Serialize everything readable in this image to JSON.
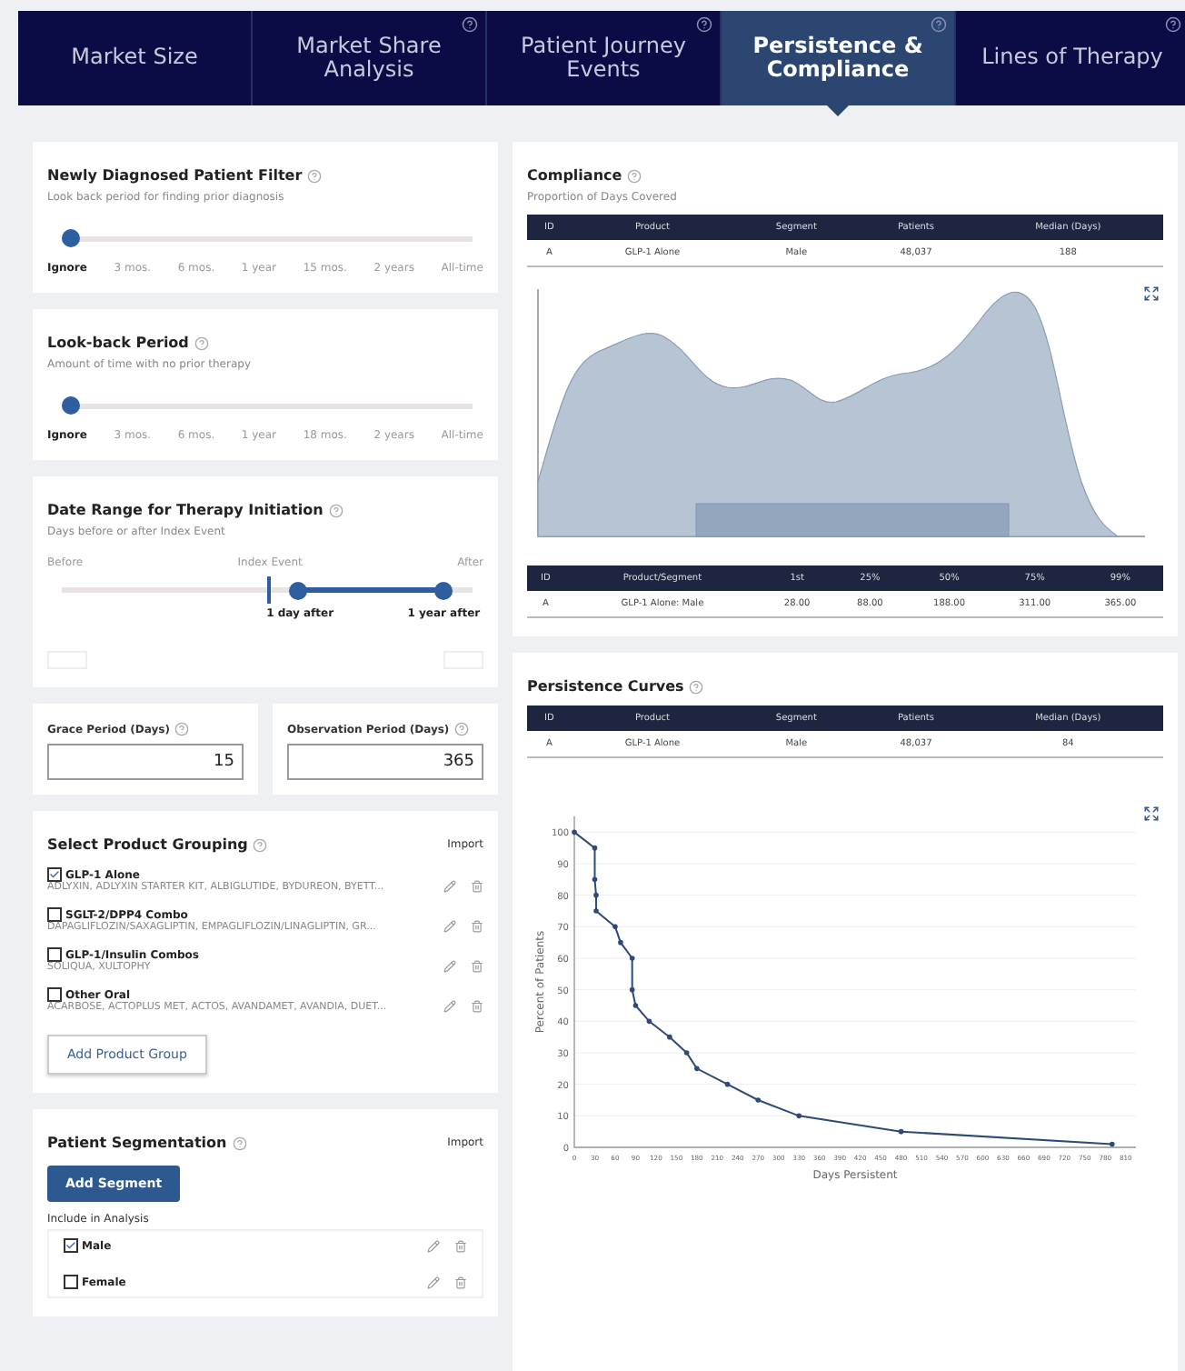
{
  "tabs": [
    {
      "label": "Market Size",
      "selected": false,
      "help": false
    },
    {
      "label": "Market Share Analysis",
      "selected": false,
      "help": true
    },
    {
      "label": "Patient Journey Events",
      "selected": false,
      "help": true
    },
    {
      "label": "Persistence & Compliance",
      "selected": true,
      "help": true
    },
    {
      "label": "Lines of Therapy",
      "selected": false,
      "help": true
    }
  ],
  "newly_diagnosed": {
    "title": "Newly Diagnosed Patient Filter",
    "subtitle": "Look back period for finding prior diagnosis",
    "level": 0,
    "ticks": [
      {
        "label": "Ignore",
        "selected": true
      },
      {
        "label": "3 mos.",
        "selected": false
      },
      {
        "label": "6 mos.",
        "selected": false
      },
      {
        "label": "1 year",
        "selected": false
      },
      {
        "label": "15 mos.",
        "selected": false
      },
      {
        "label": "2 years",
        "selected": false
      },
      {
        "label": "All-time",
        "selected": false
      }
    ]
  },
  "look_back": {
    "title": "Look-back Period",
    "subtitle": "Amount of time with no prior therapy",
    "level": 0,
    "ticks": [
      {
        "label": "Ignore",
        "selected": true
      },
      {
        "label": "3 mos.",
        "selected": false
      },
      {
        "label": "6 mos.",
        "selected": false
      },
      {
        "label": "1 year",
        "selected": false
      },
      {
        "label": "18 mos.",
        "selected": false
      },
      {
        "label": "2 years",
        "selected": false
      },
      {
        "label": "All-time",
        "selected": false
      }
    ]
  },
  "date_range": {
    "title": "Date Range for Therapy Initiation",
    "subtitle": "Days before or after Index Event",
    "left_label": "Before",
    "center_label": "Index Event",
    "right_label": "After",
    "low": {
      "level": 0.58,
      "label": "1 day after"
    },
    "high": {
      "level": 0.95,
      "label": "1 year after"
    }
  },
  "grace_period": {
    "label": "Grace Period (Days)",
    "value": "15"
  },
  "observation_period": {
    "label": "Observation Period (Days)",
    "value": "365"
  },
  "product_grouping": {
    "title": "Select Product Grouping",
    "import": "Import",
    "groups": [
      {
        "name": "GLP-1 Alone",
        "checked": true,
        "products": "ADLYXIN, ADLYXIN STARTER KIT, ALBIGLUTIDE, BYDUREON, BYETT..."
      },
      {
        "name": "SGLT-2/DPP4 Combo",
        "checked": false,
        "products": "DAPAGLIFLOZIN/SAXAGLIPTIN, EMPAGLIFLOZIN/LINAGLIPTIN, GR..."
      },
      {
        "name": "GLP-1/Insulin Combos",
        "checked": false,
        "products": "SOLIQUA, XULTOPHY"
      },
      {
        "name": "Other Oral",
        "checked": false,
        "products": "ACARBOSE, ACTOPLUS MET, ACTOS, AVANDAMET, AVANDIA, DUET..."
      }
    ],
    "add_button": "Add Product Group"
  },
  "segmentation": {
    "title": "Patient Segmentation",
    "import": "Import",
    "add_button": "Add Segment",
    "include_label": "Include in Analysis",
    "segments": [
      {
        "name": "Male",
        "checked": true
      },
      {
        "name": "Female",
        "checked": false
      }
    ]
  },
  "compliance": {
    "title": "Compliance",
    "subtitle": "Proportion of Days Covered",
    "summary": {
      "columns": [
        "ID",
        "Product",
        "Segment",
        "Patients",
        "Median (Days)"
      ],
      "rows": [
        [
          "A",
          "GLP-1 Alone",
          "Male",
          "48,037",
          "188"
        ]
      ]
    },
    "quantiles": {
      "columns": [
        "ID",
        "Product/Segment",
        "1st",
        "25%",
        "50%",
        "75%",
        "99%"
      ],
      "rows": [
        [
          "A",
          "GLP-1 Alone: Male",
          "28.00",
          "88.00",
          "188.00",
          "311.00",
          "365.00"
        ]
      ]
    }
  },
  "persistence": {
    "title": "Persistence Curves",
    "summary": {
      "columns": [
        "ID",
        "Product",
        "Segment",
        "Patients",
        "Median (Days)"
      ],
      "rows": [
        [
          "A",
          "GLP-1 Alone",
          "Male",
          "48,037",
          "84"
        ]
      ]
    },
    "chart_data": {
      "type": "line",
      "xlabel": "Days Persistent",
      "ylabel": "Percent of Patients",
      "xlim": [
        0,
        825
      ],
      "ylim": [
        0,
        105
      ],
      "xticks": [
        0,
        30,
        60,
        90,
        120,
        150,
        180,
        210,
        240,
        270,
        300,
        330,
        360,
        390,
        420,
        450,
        480,
        510,
        540,
        570,
        600,
        630,
        660,
        690,
        720,
        750,
        780,
        810
      ],
      "yticks": [
        0,
        10,
        20,
        30,
        40,
        50,
        60,
        70,
        80,
        90,
        100
      ],
      "x": [
        0,
        30,
        30,
        32,
        32,
        60,
        68,
        85,
        85,
        90,
        110,
        140,
        165,
        180,
        225,
        270,
        330,
        480,
        790
      ],
      "grid": true,
      "series": [
        {
          "color": "#2e4a78",
          "values": [
            100,
            95,
            85,
            80,
            75,
            70,
            65,
            60,
            50,
            45,
            40,
            35,
            30,
            25,
            20,
            15,
            10,
            5,
            1
          ]
        }
      ]
    }
  }
}
